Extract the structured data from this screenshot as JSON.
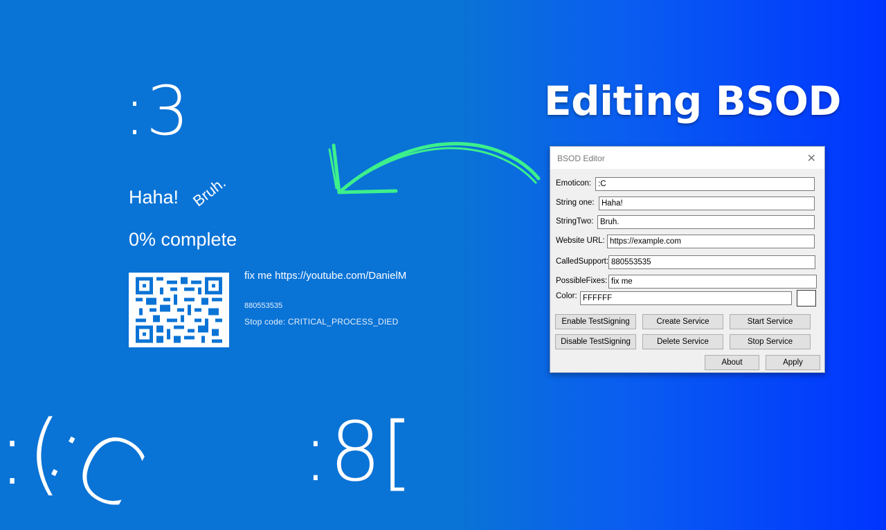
{
  "headline": "Editing BSOD",
  "bsod": {
    "emoticon": ":3",
    "string_one": "Haha!",
    "string_two": "Bruh.",
    "progress": "0% complete",
    "fix_line": "fix me https://youtube.com/DanielM",
    "support_number": "880553535",
    "stop_code": "Stop code: CRITICAL_PROCESS_DIED"
  },
  "background_faces": [
    ":(",
    ":C",
    ":8["
  ],
  "dialog": {
    "title": "BSOD Editor",
    "fields": {
      "emoticon": {
        "label": "Emoticon:",
        "value": ":C"
      },
      "string_one": {
        "label": "String one:",
        "value": "Haha!"
      },
      "string_two": {
        "label": "StringTwo:",
        "value": "Bruh."
      },
      "website_url": {
        "label": "Website URL:",
        "value": "https://example.com"
      },
      "called_support": {
        "label": "CalledSupport:",
        "value": "880553535"
      },
      "possible_fixes": {
        "label": "PossibleFixes:",
        "value": "fix me"
      },
      "color": {
        "label": "Color:",
        "value": "FFFFFF"
      }
    },
    "swatch_color": "#FFFFFF",
    "buttons": {
      "enable_testsigning": "Enable TestSigning",
      "create_service": "Create Service",
      "start_service": "Start Service",
      "disable_testsigning": "Disable TestSigning",
      "delete_service": "Delete Service",
      "stop_service": "Stop Service",
      "about": "About",
      "apply": "Apply"
    }
  },
  "colors": {
    "bsod_blue": "#0A73D6",
    "gradient_end": "#0034FF",
    "arrow_green": "#3DF08C"
  },
  "icons": [
    "close-icon",
    "qr-code-icon",
    "curved-arrow-icon"
  ]
}
